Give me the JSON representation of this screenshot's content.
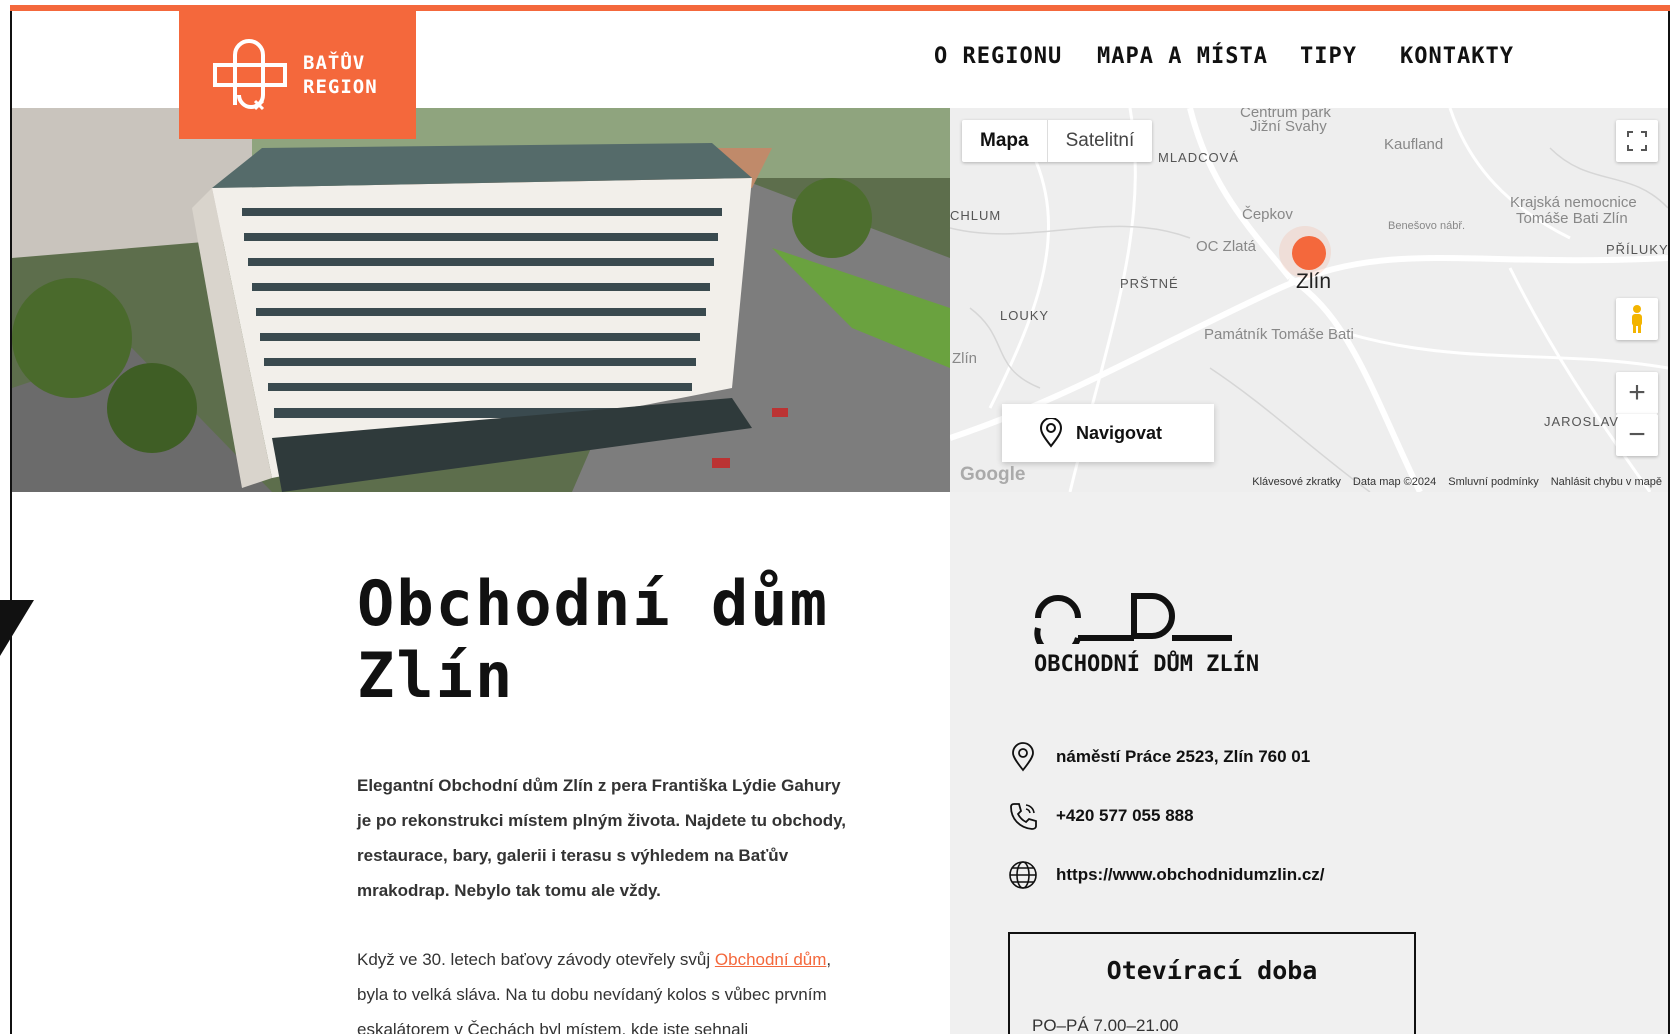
{
  "header": {
    "logo_line1": "BAŤŮV",
    "logo_line2": "REGION",
    "nav": [
      "O REGIONU",
      "MAPA A MÍSTA",
      "TIPY",
      "KONTAKTY"
    ]
  },
  "map": {
    "tab_map": "Mapa",
    "tab_satellite": "Satelitní",
    "navigate_label": "Navigovat",
    "city": "Zlín",
    "labels": {
      "centrum": "Centrum park",
      "jizni": "Jižní Svahy",
      "kaufland": "Kaufland",
      "mladcova": "MLADCOVÁ",
      "chlum": "CHLUM",
      "cepkov": "Čepkov",
      "oczlata": "OC Zlatá",
      "benesovo": "Benešovo nábř.",
      "krajska": "Krajská nemocnice",
      "krajska2": "Tomáše Bati Zlín",
      "priluky": "PŘÍLUKY",
      "prstne": "PRŠTNÉ",
      "louky": "LOUKY",
      "pamatnik": "Památník Tomáše Bati",
      "jaroslav": "JAROSLAV",
      "zlin_small": "Zlín"
    },
    "footer": [
      "Klávesové zkratky",
      "Data map ©2024",
      "Smluvní podmínky",
      "Nahlásit chybu v mapě"
    ],
    "google": "Google"
  },
  "page": {
    "title_line1": "Obchodní dům",
    "title_line2": "Zlín",
    "lead": "Elegantní Obchodní dům Zlín z pera Františka Lýdie Gahury je po rekonstrukci místem plným života. Najdete tu obchody, restaurace, bary, galerii i terasu s výhledem na Baťův mrakodrap. Nebylo tak tomu ale vždy.",
    "body_before": "Když ve 30. letech baťovy závody otevřely svůj ",
    "body_link": "Obchodní dům",
    "body_after": ", byla to velká sláva. Na tu dobu nevídaný kolos s vůbec prvním eskalátorem v Čechách byl místem, kde jste sehnali"
  },
  "sidebar": {
    "brand": "OBCHODNÍ DŮM ZLÍN",
    "address": "náměstí Práce 2523, Zlín 760 01",
    "phone": "+420 577 055 888",
    "web": "https://www.obchodnidumzlin.cz/",
    "hours_title": "Otevírací doba",
    "hours_line": "PO–PÁ 7.00–21.00"
  },
  "colors": {
    "accent": "#f4683c"
  }
}
